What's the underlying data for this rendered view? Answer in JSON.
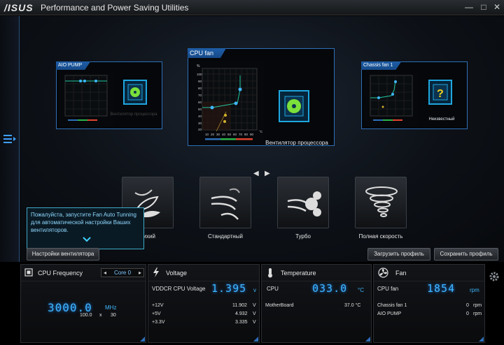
{
  "window": {
    "logo": "/ISUS",
    "title": "Performance and Power Saving Utilities"
  },
  "fans": {
    "left": {
      "tab": "AIO PUMP",
      "label": "Вентилятор процессора"
    },
    "center": {
      "tab": "CPU fan",
      "label": "Вентилятор процессора",
      "x_unit": "°C",
      "x_ticks": [
        "10",
        "20",
        "30",
        "40",
        "50",
        "60",
        "70",
        "80",
        "90",
        "100"
      ],
      "y_ticks": [
        "%",
        "100",
        "90",
        "80",
        "70",
        "60",
        "50",
        "40",
        "30",
        "20",
        "10"
      ]
    },
    "right": {
      "tab": "Chassis fan 1",
      "label": "Неизвестный"
    }
  },
  "modes": [
    {
      "label": "Тихий"
    },
    {
      "label": "Стандартный"
    },
    {
      "label": "Турбо"
    },
    {
      "label": "Полная скорость"
    }
  ],
  "tooltip": {
    "text": "Пожалуйста, запустите Fan Auto Tunning для автоматической настройки Ваших вентиляторов."
  },
  "buttons": {
    "fan_settings": "Настройки вентилятора",
    "load_profile": "Загрузить профиль",
    "save_profile": "Сохранить профиль"
  },
  "cpu_freq": {
    "title": "CPU Frequency",
    "core_select": "Core 0",
    "value": "3000.0",
    "unit": "MHz",
    "bclk": "100.0",
    "x": "x",
    "ratio": "30"
  },
  "voltage": {
    "title": "Voltage",
    "main_label": "VDDCR CPU Voltage",
    "main_value": "1.395",
    "main_unit": "v",
    "rows": [
      {
        "label": "+12V",
        "value": "11.902",
        "unit": "V"
      },
      {
        "label": "+5V",
        "value": "4.932",
        "unit": "V"
      },
      {
        "label": "+3.3V",
        "value": "3.335",
        "unit": "V"
      }
    ]
  },
  "temperature": {
    "title": "Temperature",
    "main_label": "CPU",
    "main_value": "033.0",
    "main_unit": "°C",
    "rows": [
      {
        "label": "MotherBoard",
        "value": "37.0 °C"
      }
    ]
  },
  "fan_panel": {
    "title": "Fan",
    "main_label": "CPU fan",
    "main_value": "1854",
    "main_unit": "rpm",
    "rows": [
      {
        "label": "Chassis fan 1",
        "value": "0",
        "unit": "rpm"
      },
      {
        "label": "AIO PUMP",
        "value": "0",
        "unit": "rpm"
      }
    ]
  },
  "colors": {
    "accent": "#2e6fb8",
    "lcd": "#3fb7ff",
    "curve": "#1fc6a0",
    "fan_green": "#7be03a"
  }
}
